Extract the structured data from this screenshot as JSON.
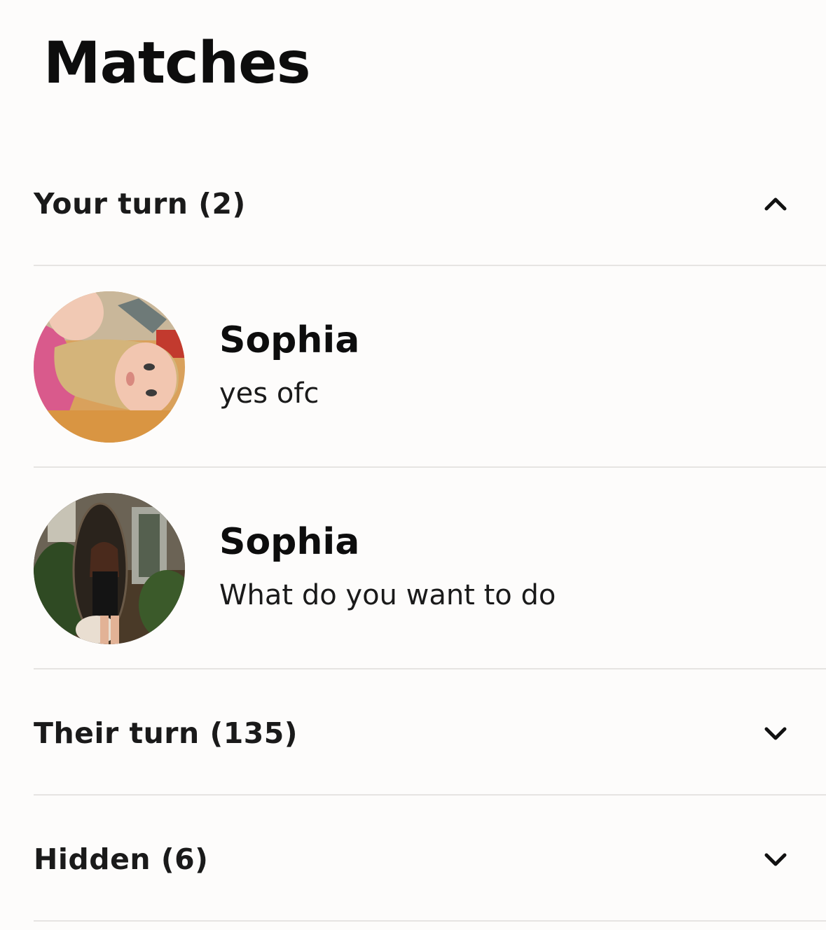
{
  "page": {
    "title": "Matches"
  },
  "sections": {
    "your_turn": {
      "label": "Your turn (2)",
      "expanded": true,
      "chevron_icon": "chevron-up-icon"
    },
    "their_turn": {
      "label": "Their turn (135)",
      "expanded": false,
      "chevron_icon": "chevron-down-icon"
    },
    "hidden": {
      "label": "Hidden (6)",
      "expanded": false,
      "chevron_icon": "chevron-down-icon"
    }
  },
  "matches": [
    {
      "name": "Sophia",
      "last_message": "yes ofc"
    },
    {
      "name": "Sophia",
      "last_message": "What do you want to do"
    }
  ],
  "colors": {
    "background": "#fdfcfb",
    "text_primary": "#0d0d0d",
    "divider": "#e6e4e2"
  }
}
